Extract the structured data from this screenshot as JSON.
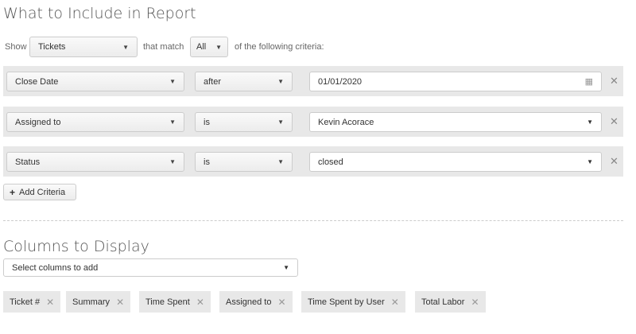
{
  "report": {
    "title": "What to Include in Report",
    "show_label": "Show",
    "entity": "Tickets",
    "that_match": "that match",
    "match": "All",
    "criteria_suffix": "of the following criteria:"
  },
  "criteria": [
    {
      "field": "Close Date",
      "operator": "after",
      "value": "01/01/2020",
      "value_type": "date"
    },
    {
      "field": "Assigned to",
      "operator": "is",
      "value": "Kevin Acorace",
      "value_type": "select"
    },
    {
      "field": "Status",
      "operator": "is",
      "value": "closed",
      "value_type": "select"
    }
  ],
  "add_criteria": "Add Criteria",
  "columns": {
    "title": "Columns to Display",
    "placeholder": "Select columns to add",
    "chips": [
      "Ticket #",
      "Summary",
      "Time Spent",
      "Assigned to",
      "Time Spent by User",
      "Total Labor"
    ]
  }
}
